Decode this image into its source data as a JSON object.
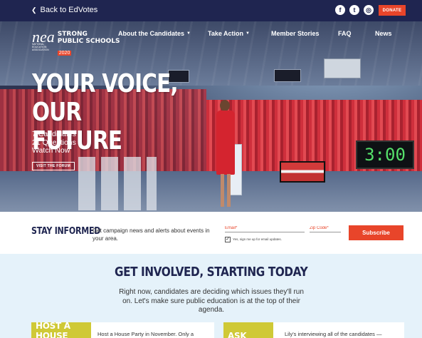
{
  "topbar": {
    "back_label": "Back to EdVotes",
    "social": {
      "facebook": "f",
      "twitter": "t",
      "instagram": "◎"
    },
    "donate_label": "DONATE"
  },
  "logo": {
    "nea": "nea",
    "subline": "NATIONAL EDUCATION ASSOCIATION",
    "strong_line1": "STRONG",
    "strong_line2": "PUBLIC SCHOOLS",
    "year": "2020"
  },
  "nav": {
    "items": [
      {
        "label": "About the Candidates",
        "caret": true
      },
      {
        "label": "Take Action",
        "caret": true
      },
      {
        "label": "Member Stories",
        "caret": false
      },
      {
        "label": "FAQ",
        "caret": false
      },
      {
        "label": "News",
        "caret": false
      }
    ]
  },
  "hero": {
    "title_line1": "YOUR VOICE, OUR",
    "title_line2": "FUTURE",
    "line1": "7 Candidates",
    "line2": "21 Questions",
    "line3": "Watch Now",
    "button_label": "VISIT THE FORUM",
    "timer": "3:00"
  },
  "stay_informed": {
    "title": "STAY INFORMED",
    "text": "Get campaign news and alerts about events in your area.",
    "email_placeholder": "Email*",
    "zip_placeholder": "Zip Code*",
    "checkbox_label": "Yes, sign me up for email updates.",
    "checked": true,
    "subscribe_label": "Subscribe"
  },
  "get_involved": {
    "title": "GET INVOLVED, STARTING TODAY",
    "text": "Right now, candidates are deciding which issues they'll run on. Let's make sure public education is at the top of their agenda.",
    "cards": [
      {
        "tag": "HOST A HOUSE",
        "text": "Host a House Party in November. Only a"
      },
      {
        "tag": "ASK",
        "text": "Lily's interviewing all of the candidates —"
      }
    ]
  },
  "colors": {
    "navy": "#1f2550",
    "accent": "#e8452a",
    "tag": "#cfc936",
    "band": "#e5f2fa"
  }
}
